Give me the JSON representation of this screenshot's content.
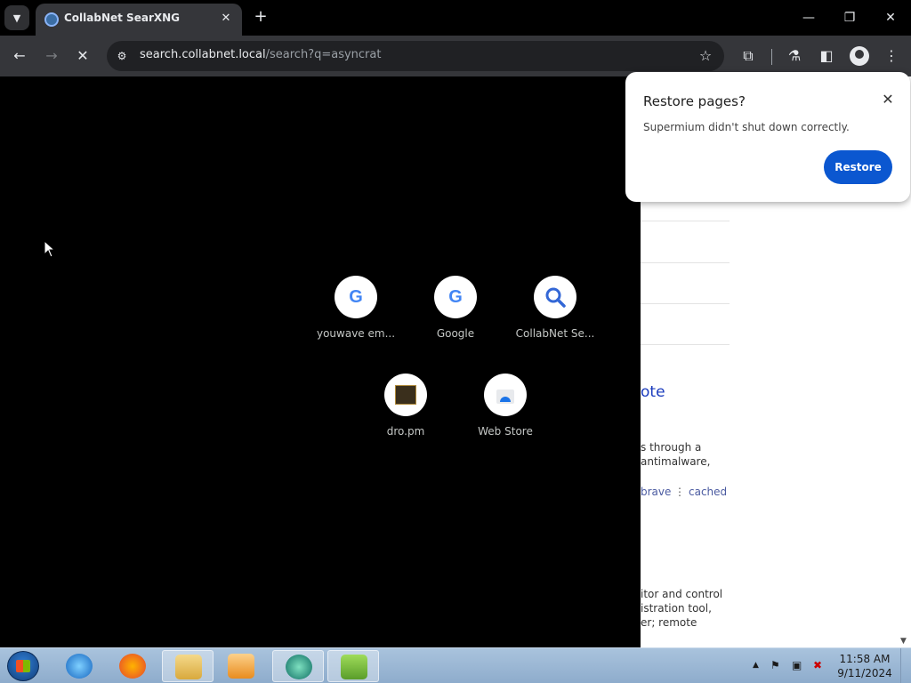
{
  "browser": {
    "tab_title": "CollabNet SearXNG",
    "url_host": "search.collabnet.local",
    "url_path": "/search?q=asyncrat"
  },
  "shortcuts": [
    {
      "label": "youwave em...",
      "icon": "google-icon"
    },
    {
      "label": "Google",
      "icon": "google-icon"
    },
    {
      "label": "CollabNet Se...",
      "icon": "search-icon"
    },
    {
      "label": "dro.pm",
      "icon": "dropm-icon"
    },
    {
      "label": "Web Store",
      "icon": "webstore-icon"
    }
  ],
  "popup": {
    "title": "Restore pages?",
    "message": "Supermium didn't shut down correctly.",
    "button": "Restore"
  },
  "page_behind": {
    "link_fragment": "ote",
    "snippet1": [
      "s through a",
      "antimalware,"
    ],
    "meta": [
      "brave",
      "cached"
    ],
    "snippet2": [
      "itor and control",
      "istration tool,",
      "er; remote"
    ]
  },
  "taskbar": {
    "time": "11:58 AM",
    "date": "9/11/2024"
  },
  "colors": {
    "accent_button": "#0b57d0",
    "toolbar": "#35363a",
    "page_link": "#1a3bbd"
  }
}
